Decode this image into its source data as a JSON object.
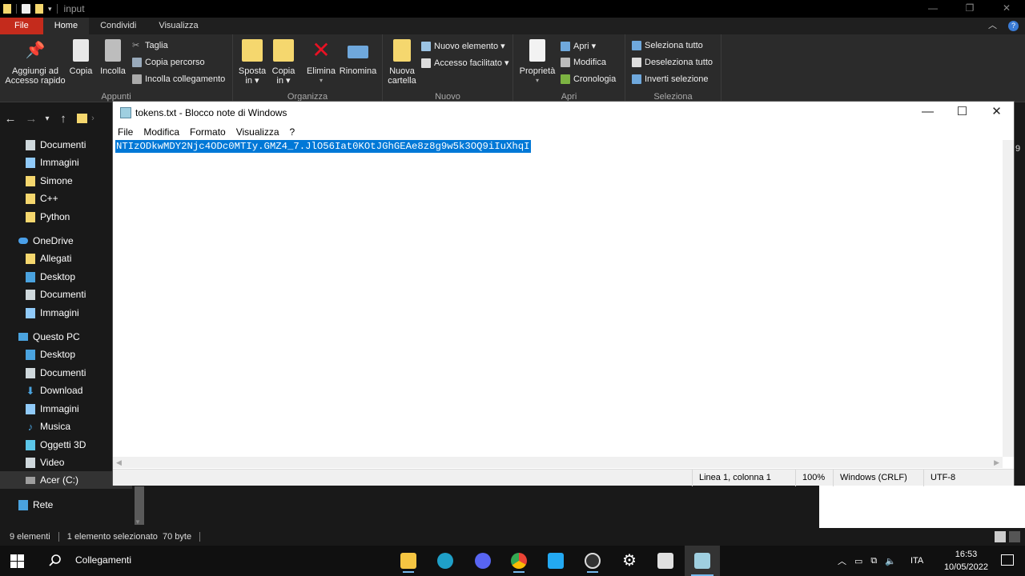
{
  "explorer": {
    "title": "input",
    "tabs": [
      "File",
      "Home",
      "Condividi",
      "Visualizza"
    ],
    "ribbon": {
      "appunti": {
        "label": "Appunti",
        "pin": "Aggiungi ad Accesso rapido",
        "pin_line1": "Aggiungi ad",
        "pin_line2": "Accesso rapido",
        "copia": "Copia",
        "incolla": "Incolla",
        "taglia": "Taglia",
        "copia_percorso": "Copia percorso",
        "incolla_collegamento": "Incolla collegamento"
      },
      "organizza": {
        "label": "Organizza",
        "sposta_line1": "Sposta",
        "sposta_line2": "in ▾",
        "copia_line1": "Copia",
        "copia_line2": "in ▾",
        "elimina": "Elimina",
        "rinomina": "Rinomina"
      },
      "nuovo": {
        "label": "Nuovo",
        "cartella_line1": "Nuova",
        "cartella_line2": "cartella",
        "nuovo_elemento": "Nuovo elemento ▾",
        "accesso_facilitato": "Accesso facilitato ▾"
      },
      "apri": {
        "label": "Apri",
        "proprieta": "Proprietà",
        "apri": "Apri ▾",
        "modifica": "Modifica",
        "cronologia": "Cronologia"
      },
      "seleziona": {
        "label": "Seleziona",
        "tutto": "Seleziona tutto",
        "deseleziona": "Deseleziona tutto",
        "inverti": "Inverti selezione"
      }
    },
    "sidebar": {
      "quick": [
        {
          "label": "Documenti",
          "icon": "documents-icon"
        },
        {
          "label": "Immagini",
          "icon": "pictures-icon"
        },
        {
          "label": "Simone",
          "icon": "folder-icon"
        },
        {
          "label": "C++",
          "icon": "folder-icon"
        },
        {
          "label": "Python",
          "icon": "folder-icon"
        }
      ],
      "onedrive": {
        "label": "OneDrive",
        "items": [
          {
            "label": "Allegati",
            "icon": "folder-icon"
          },
          {
            "label": "Desktop",
            "icon": "desktop-icon"
          },
          {
            "label": "Documenti",
            "icon": "documents-icon"
          },
          {
            "label": "Immagini",
            "icon": "pictures-icon"
          }
        ]
      },
      "pc": {
        "label": "Questo PC",
        "items": [
          {
            "label": "Desktop",
            "icon": "desktop-icon"
          },
          {
            "label": "Documenti",
            "icon": "documents-icon"
          },
          {
            "label": "Download",
            "icon": "download-icon"
          },
          {
            "label": "Immagini",
            "icon": "pictures-icon"
          },
          {
            "label": "Musica",
            "icon": "music-icon"
          },
          {
            "label": "Oggetti 3D",
            "icon": "3d-objects-icon"
          },
          {
            "label": "Video",
            "icon": "video-icon"
          },
          {
            "label": "Acer (C:)",
            "icon": "drive-icon"
          }
        ]
      },
      "rete": "Rete"
    },
    "status": {
      "count": "9 elementi",
      "selection": "1 elemento selezionato  70 byte"
    },
    "edge_char": "9"
  },
  "notepad": {
    "title": "tokens.txt - Blocco note di Windows",
    "menu": [
      "File",
      "Modifica",
      "Formato",
      "Visualizza",
      "?"
    ],
    "content": "NTIzODkwMDY2Njc4ODc0MTIy.GMZ4_7.JlO56Iat0KOtJGhGEAe8z8g9w5k3OQ9iIuXhqI",
    "status": {
      "position": "Linea 1, colonna 1",
      "zoom": "100%",
      "line_ending": "Windows (CRLF)",
      "encoding": "UTF-8"
    }
  },
  "taskbar": {
    "search_label": "Collegamenti",
    "language": "ITA",
    "time": "16:53",
    "date": "10/05/2022"
  },
  "colors": {
    "file_tab": "#c42b1c",
    "selection": "#0078d7",
    "folder": "#f5d76e"
  }
}
